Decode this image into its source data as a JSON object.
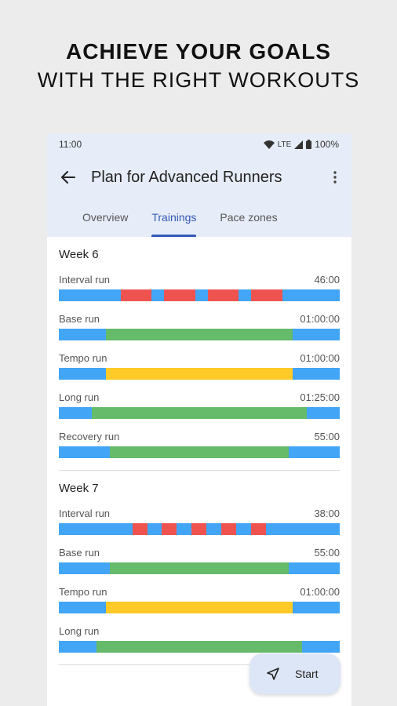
{
  "headline": {
    "line1": "ACHIEVE YOUR GOALS",
    "line2": "WITH THE RIGHT WORKOUTS"
  },
  "status_bar": {
    "time": "11:00",
    "network": "LTE",
    "battery": "100%"
  },
  "toolbar": {
    "title": "Plan for Advanced Runners"
  },
  "tabs": [
    {
      "label": "Overview",
      "active": false
    },
    {
      "label": "Trainings",
      "active": true
    },
    {
      "label": "Pace zones",
      "active": false
    }
  ],
  "colors": {
    "easy": "#42a5f5",
    "interval": "#ef5350",
    "base": "#66bb6a",
    "tempo": "#ffca28",
    "accent": "#3457b8"
  },
  "weeks": [
    {
      "title": "Week 6",
      "workouts": [
        {
          "name": "Interval run",
          "duration": "46:00",
          "segments": [
            [
              "easy",
              22
            ],
            [
              "interval",
              11
            ],
            [
              "easy",
              4.5
            ],
            [
              "interval",
              11
            ],
            [
              "easy",
              4.5
            ],
            [
              "interval",
              11
            ],
            [
              "easy",
              4.5
            ],
            [
              "interval",
              11
            ],
            [
              "easy",
              20.5
            ]
          ]
        },
        {
          "name": "Base run",
          "duration": "01:00:00",
          "segments": [
            [
              "easy",
              16.7
            ],
            [
              "base",
              66.6
            ],
            [
              "easy",
              16.7
            ]
          ]
        },
        {
          "name": "Tempo run",
          "duration": "01:00:00",
          "segments": [
            [
              "easy",
              16.7
            ],
            [
              "tempo",
              66.6
            ],
            [
              "easy",
              16.7
            ]
          ]
        },
        {
          "name": "Long run",
          "duration": "01:25:00",
          "segments": [
            [
              "easy",
              11.8
            ],
            [
              "base",
              76.4
            ],
            [
              "easy",
              11.8
            ]
          ]
        },
        {
          "name": "Recovery run",
          "duration": "55:00",
          "segments": [
            [
              "easy",
              18.2
            ],
            [
              "base",
              63.6
            ],
            [
              "easy",
              18.2
            ]
          ]
        }
      ]
    },
    {
      "title": "Week 7",
      "workouts": [
        {
          "name": "Interval run",
          "duration": "38:00",
          "segments": [
            [
              "easy",
              26.3
            ],
            [
              "interval",
              5.3
            ],
            [
              "easy",
              5.3
            ],
            [
              "interval",
              5.3
            ],
            [
              "easy",
              5.3
            ],
            [
              "interval",
              5.3
            ],
            [
              "easy",
              5.3
            ],
            [
              "interval",
              5.3
            ],
            [
              "easy",
              5.3
            ],
            [
              "interval",
              5.3
            ],
            [
              "easy",
              26.5
            ]
          ]
        },
        {
          "name": "Base run",
          "duration": "55:00",
          "segments": [
            [
              "easy",
              18.2
            ],
            [
              "base",
              63.6
            ],
            [
              "easy",
              18.2
            ]
          ]
        },
        {
          "name": "Tempo run",
          "duration": "01:00:00",
          "segments": [
            [
              "easy",
              16.7
            ],
            [
              "tempo",
              66.6
            ],
            [
              "easy",
              16.7
            ]
          ]
        },
        {
          "name": "Long run",
          "duration": "",
          "segments": [
            [
              "easy",
              13.5
            ],
            [
              "base",
              73
            ],
            [
              "easy",
              13.5
            ]
          ]
        }
      ]
    }
  ],
  "fab": {
    "label": "Start"
  }
}
